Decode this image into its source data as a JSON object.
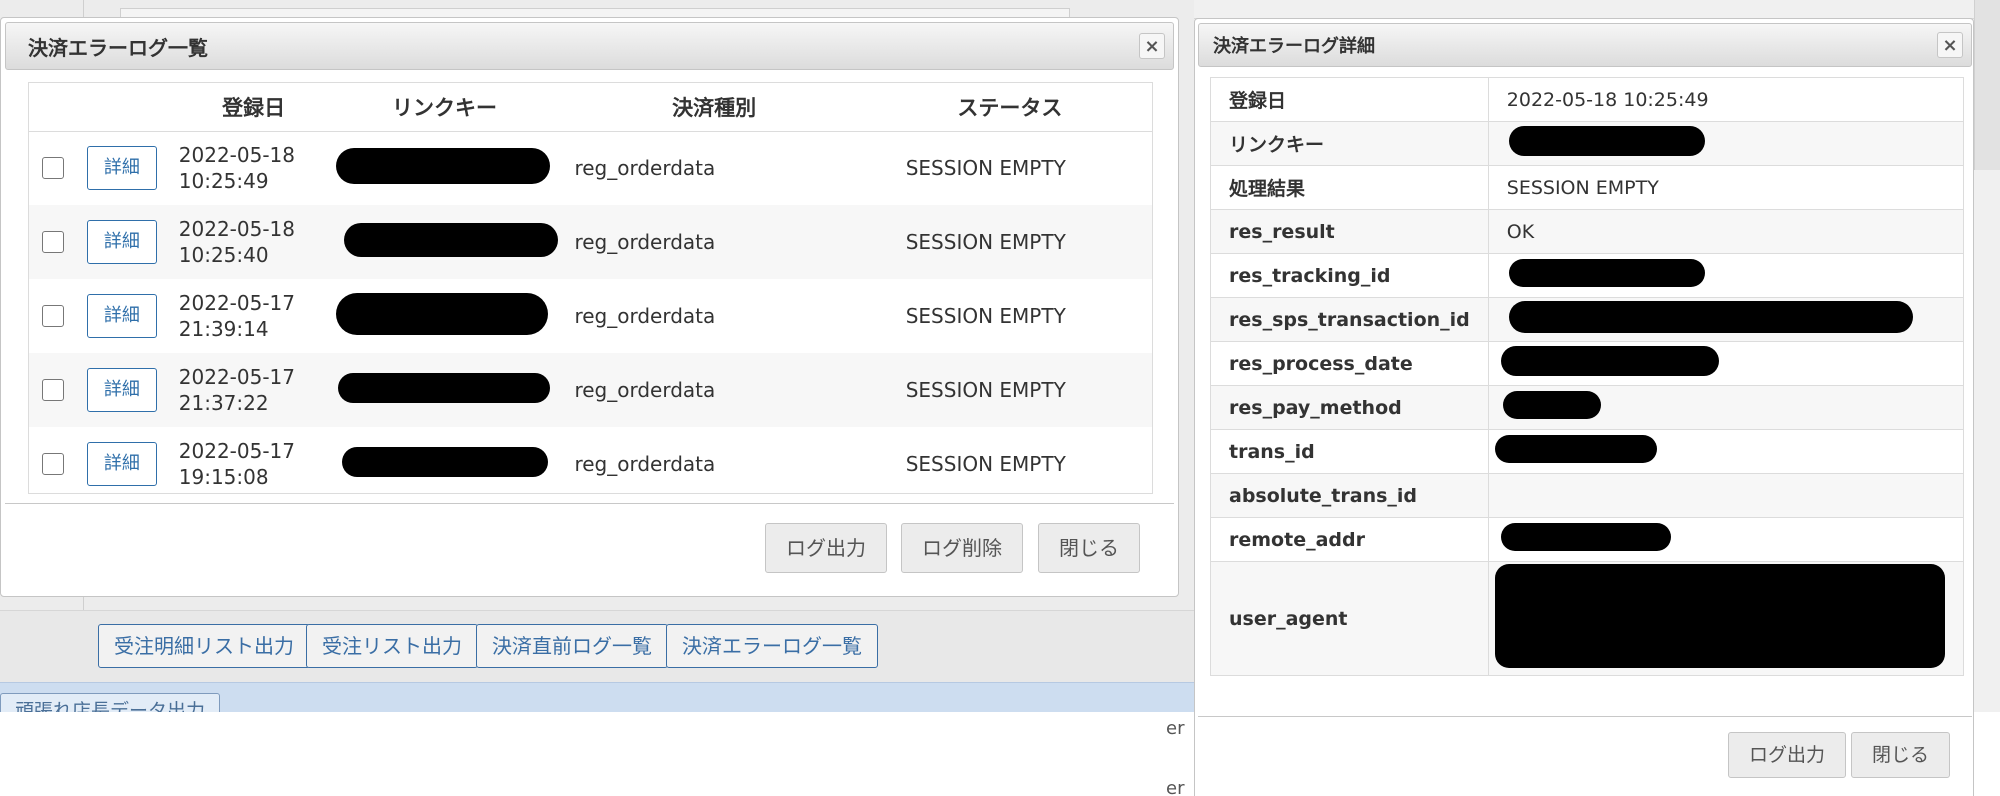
{
  "background": {
    "buttons": [
      "受注明細リスト出力",
      "受注リスト出力",
      "決済直前ログ一覧",
      "決済エラーログ一覧"
    ],
    "partial_button": "頑張れ店長データ出力",
    "peek_text": [
      "er",
      "er"
    ]
  },
  "list_dialog": {
    "title": "決済エラーログ一覧",
    "close_icon": "×",
    "columns": [
      "",
      "",
      "登録日",
      "リンクキー",
      "決済種別",
      "ステータス"
    ],
    "detail_label": "詳細",
    "rows": [
      {
        "date": "2022-05-18",
        "time": "10:25:49",
        "link_key": "[redacted]",
        "type": "reg_orderdata",
        "status": "SESSION EMPTY"
      },
      {
        "date": "2022-05-18",
        "time": "10:25:40",
        "link_key": "[redacted]",
        "type": "reg_orderdata",
        "status": "SESSION EMPTY"
      },
      {
        "date": "2022-05-17",
        "time": "21:39:14",
        "link_key": "[redacted]",
        "type": "reg_orderdata",
        "status": "SESSION EMPTY"
      },
      {
        "date": "2022-05-17",
        "time": "21:37:22",
        "link_key": "[redacted]",
        "type": "reg_orderdata",
        "status": "SESSION EMPTY"
      },
      {
        "date": "2022-05-17",
        "time": "19:15:08",
        "link_key": "[redacted]",
        "type": "reg_orderdata",
        "status": "SESSION EMPTY"
      }
    ],
    "footer_buttons": {
      "export": "ログ出力",
      "delete": "ログ削除",
      "close": "閉じる"
    }
  },
  "detail_dialog": {
    "title": "決済エラーログ詳細",
    "close_icon": "×",
    "rows": [
      {
        "key": "登録日",
        "value": "2022-05-18 10:25:49"
      },
      {
        "key": "リンクキー",
        "value": ""
      },
      {
        "key": "処理結果",
        "value": "SESSION EMPTY"
      },
      {
        "key": "res_result",
        "value": "OK"
      },
      {
        "key": "res_tracking_id",
        "value": ""
      },
      {
        "key": "res_sps_transaction_id",
        "value": ""
      },
      {
        "key": "res_process_date",
        "value": ""
      },
      {
        "key": "res_pay_method",
        "value": ""
      },
      {
        "key": "trans_id",
        "value": ""
      },
      {
        "key": "absolute_trans_id",
        "value": ""
      },
      {
        "key": "remote_addr",
        "value": ""
      },
      {
        "key": "user_agent",
        "value": ""
      }
    ],
    "footer_buttons": {
      "export": "ログ出力",
      "close": "閉じる"
    }
  }
}
